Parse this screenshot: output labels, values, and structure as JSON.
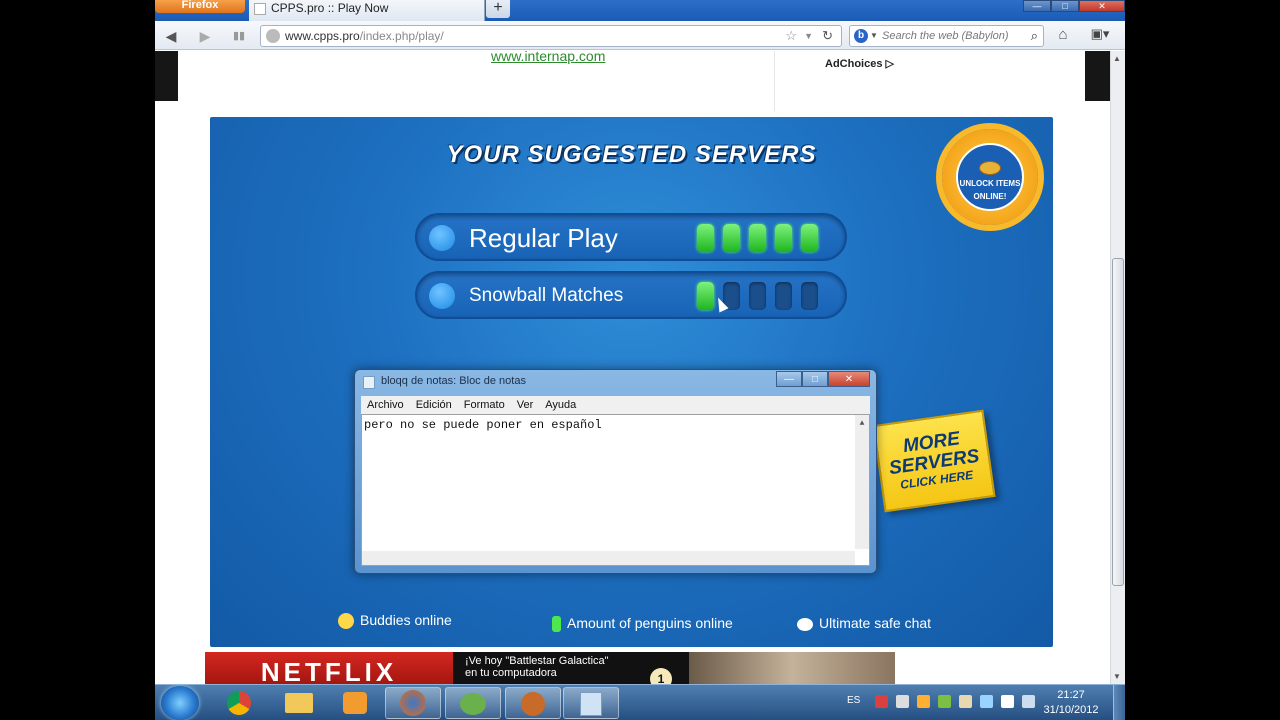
{
  "browser": {
    "app_button": "Firefox",
    "tab_title": "CPPS.pro :: Play Now",
    "new_tab": "+",
    "url_host": "www.cpps.pro",
    "url_path": "/index.php/play/",
    "search_placeholder": "Search the web (Babylon)",
    "window_controls": {
      "minimize": "—",
      "maximize": "□",
      "close": "✕"
    }
  },
  "ad": {
    "link_text": "www.internap.com",
    "adchoices": "AdChoices ▷"
  },
  "panel": {
    "title": "YOUR SUGGESTED SERVERS",
    "badge_text": "UNLOCK ITEMS ONLINE!",
    "servers": [
      {
        "name": "Regular Play",
        "bars_total": 5,
        "bars_on": 5
      },
      {
        "name": "Snowball Matches",
        "bars_total": 5,
        "bars_on": 1
      }
    ],
    "more_servers_line1": "MORE SERVERS",
    "more_servers_line2": "CLICK HERE",
    "legend": {
      "buddies": "Buddies online",
      "penguins": "Amount of penguins online",
      "chat": "Ultimate safe chat"
    }
  },
  "notepad": {
    "title": "bloqq de notas: Bloc de notas",
    "menu": [
      "Archivo",
      "Edición",
      "Formato",
      "Ver",
      "Ayuda"
    ],
    "content": "pero no se puede poner en español",
    "controls": {
      "minimize": "—",
      "maximize": "□",
      "close": "✕"
    }
  },
  "banner": {
    "brand": "NETFLIX",
    "line1": "¡Ve hoy \"Battlestar Galactica\"",
    "line2": "en tu computadora",
    "badge": "1"
  },
  "taskbar": {
    "language": "ES",
    "time": "21:27",
    "date": "31/10/2012",
    "apps": [
      "chrome",
      "explorer",
      "media-player",
      "firefox",
      "messenger",
      "game",
      "notepad"
    ]
  },
  "colors": {
    "panel_blue": "#1d6fc0",
    "bar_on": "#1fb51f",
    "note_yellow": "#f5c614",
    "netflix_red": "#d32820"
  }
}
